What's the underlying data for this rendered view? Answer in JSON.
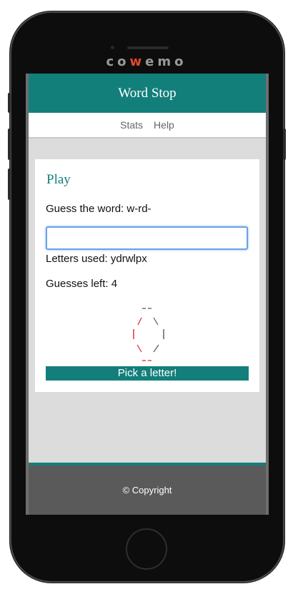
{
  "device": {
    "brand_prefix": "co",
    "brand_accent": "w",
    "brand_suffix": "emo"
  },
  "app": {
    "title": "Word Stop"
  },
  "nav": {
    "items": [
      {
        "label": "Stats"
      },
      {
        "label": "Help"
      }
    ]
  },
  "game": {
    "heading": "Play",
    "guess_label": "Guess the word: w-rd-",
    "input_value": "",
    "letters_used": "Letters used: ydrwlpx",
    "guesses_left": "Guesses left: 4",
    "pick_button": "Pick a letter!"
  },
  "footer": {
    "text": "© Copyright"
  },
  "colors": {
    "primary": "#137f7b",
    "footer_bg": "#5a5a5a",
    "hangman_red": "#e0202a",
    "hangman_gray": "#555555"
  }
}
